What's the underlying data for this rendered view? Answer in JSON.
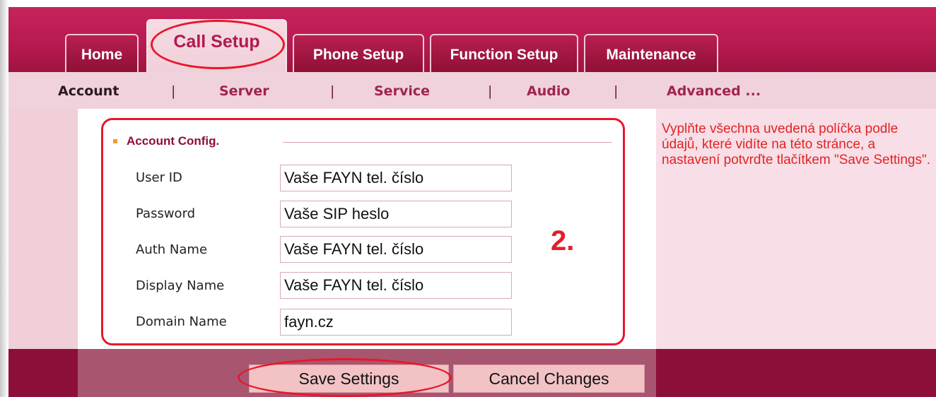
{
  "tabs": [
    {
      "label": "Home"
    },
    {
      "label": "Call Setup",
      "active": true
    },
    {
      "label": "Phone Setup"
    },
    {
      "label": "Function Setup"
    },
    {
      "label": "Maintenance"
    }
  ],
  "subnav": [
    {
      "label": "Account",
      "active": true
    },
    {
      "label": "Server"
    },
    {
      "label": "Service"
    },
    {
      "label": "Audio"
    },
    {
      "label": "Advanced ..."
    }
  ],
  "subnav_separator": "|",
  "section": {
    "title": "Account Config."
  },
  "fields": [
    {
      "label": "User ID",
      "value": "Vaše FAYN tel. číslo"
    },
    {
      "label": "Password",
      "value": "Vaše SIP heslo"
    },
    {
      "label": "Auth Name",
      "value": "Vaše FAYN tel. číslo"
    },
    {
      "label": "Display Name",
      "value": "Vaše FAYN tel. číslo"
    },
    {
      "label": "Domain Name",
      "value": "fayn.cz"
    }
  ],
  "annotation": {
    "step_number": "2."
  },
  "hint": {
    "text": "Vyplňte všechna uvedená políčka podle údajů, které vidíte na této stránce, a nastavení potvrďte tlačítkem \"Save Settings\"."
  },
  "buttons": {
    "save": "Save Settings",
    "cancel": "Cancel Changes"
  },
  "colors": {
    "accent": "#c7235c",
    "annotation_red": "#e8172b",
    "dark_maroon": "#8c0f3a"
  }
}
